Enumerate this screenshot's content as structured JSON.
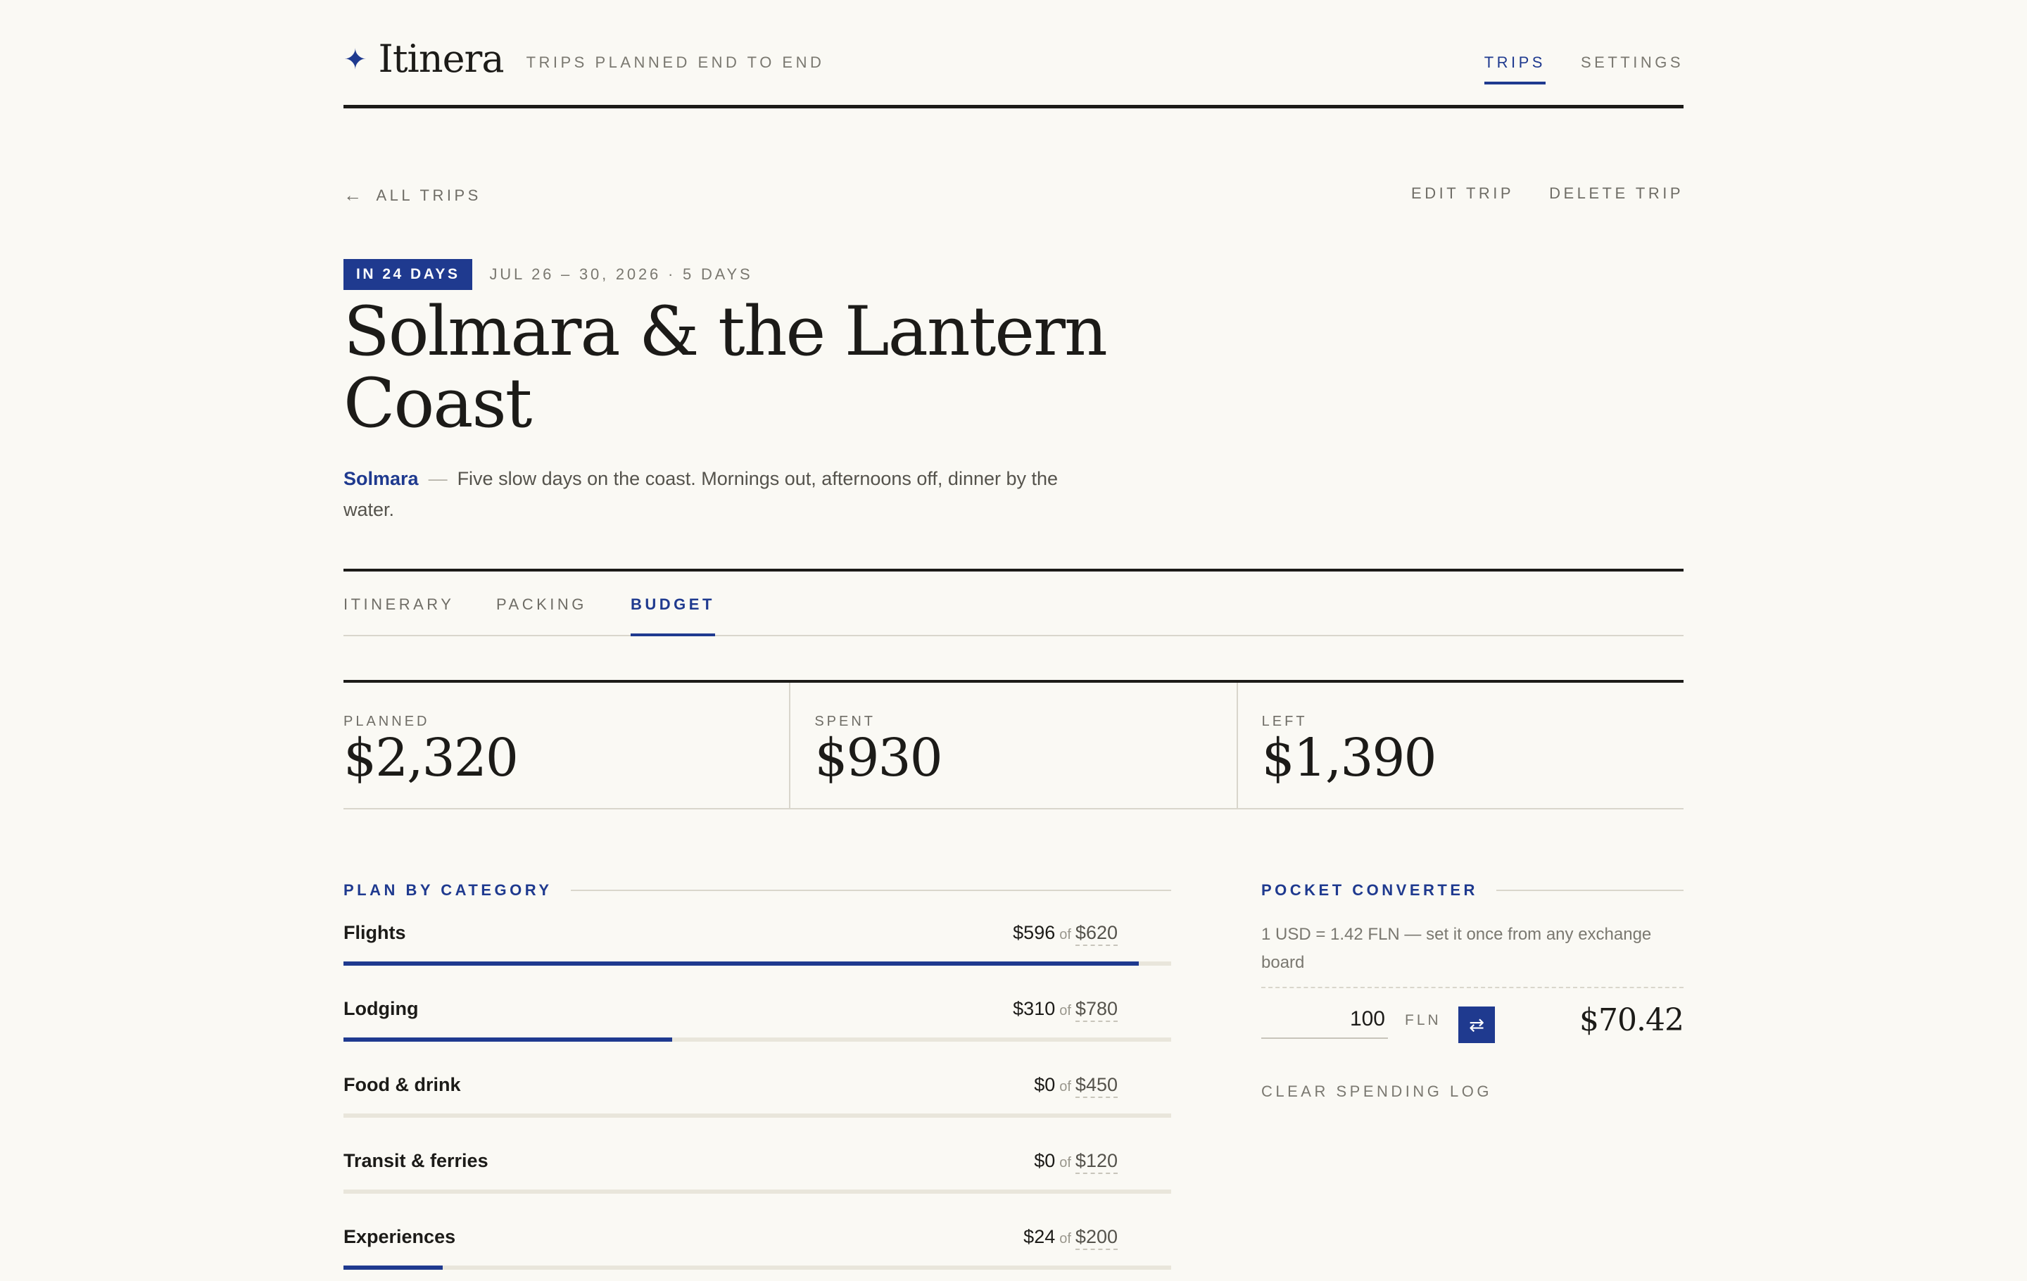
{
  "app": {
    "name": "Itinera",
    "tagline": "TRIPS PLANNED END TO END",
    "nav": [
      {
        "label": "TRIPS",
        "active": true
      },
      {
        "label": "SETTINGS",
        "active": false
      }
    ]
  },
  "actions": {
    "back_label": "ALL TRIPS",
    "edit_label": "EDIT TRIP",
    "delete_label": "DELETE TRIP"
  },
  "trip": {
    "badge": "IN 24 DAYS",
    "dates": "JUL 26 – 30, 2026 · 5 DAYS",
    "title": "Solmara & the Lantern Coast",
    "place": "Solmara",
    "description": "Five slow days on the coast. Mornings out, afternoons off, dinner by the water."
  },
  "tabs": [
    {
      "label": "ITINERARY",
      "active": false
    },
    {
      "label": "PACKING",
      "active": false
    },
    {
      "label": "BUDGET",
      "active": true
    }
  ],
  "stats": [
    {
      "label": "PLANNED",
      "value": "$2,320"
    },
    {
      "label": "SPENT",
      "value": "$930"
    },
    {
      "label": "LEFT",
      "value": "$1,390"
    }
  ],
  "plan": {
    "heading": "PLAN BY CATEGORY",
    "of_word": "of",
    "categories": [
      {
        "name": "Flights",
        "spent": "$596",
        "planned": "$620",
        "progress": 0.961
      },
      {
        "name": "Lodging",
        "spent": "$310",
        "planned": "$780",
        "progress": 0.397
      },
      {
        "name": "Food & drink",
        "spent": "$0",
        "planned": "$450",
        "progress": 0
      },
      {
        "name": "Transit & ferries",
        "spent": "$0",
        "planned": "$120",
        "progress": 0
      },
      {
        "name": "Experiences",
        "spent": "$24",
        "planned": "$200",
        "progress": 0.12
      }
    ]
  },
  "converter": {
    "heading": "POCKET CONVERTER",
    "note": "1 USD = 1.42 FLN — set it once from any exchange board",
    "amount": "100",
    "currency": "FLN",
    "result": "$70.42",
    "clear_label": "CLEAR SPENDING LOG"
  },
  "colors": {
    "accent": "#1f3a8f",
    "ink": "#1c1b18",
    "background": "#faf9f4"
  },
  "icons": {
    "brand": "sparkle-icon",
    "back": "arrow-left-icon",
    "swap": "swap-arrows-icon"
  }
}
